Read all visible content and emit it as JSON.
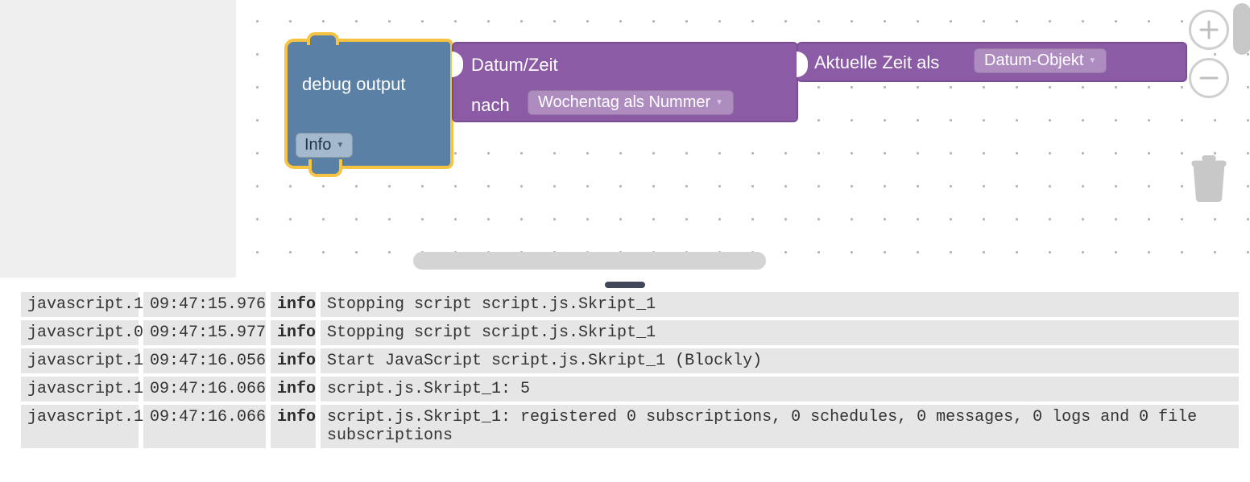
{
  "blocks": {
    "debug": {
      "label": "debug output",
      "level_field": "Info"
    },
    "datetime": {
      "header": "Datum/Zeit",
      "nach": "nach",
      "unit_field": "Wochentag als Nummer"
    },
    "now": {
      "label": "Aktuelle Zeit als",
      "format_field": "Datum-Objekt"
    }
  },
  "log": [
    {
      "source": "javascript.1",
      "time": "09:47:15.976",
      "level": "info",
      "message": "Stopping script script.js.Skript_1"
    },
    {
      "source": "javascript.0",
      "time": "09:47:15.977",
      "level": "info",
      "message": "Stopping script script.js.Skript_1"
    },
    {
      "source": "javascript.1",
      "time": "09:47:16.056",
      "level": "info",
      "message": "Start JavaScript script.js.Skript_1 (Blockly)"
    },
    {
      "source": "javascript.1",
      "time": "09:47:16.066",
      "level": "info",
      "message": "script.js.Skript_1: 5"
    },
    {
      "source": "javascript.1",
      "time": "09:47:16.066",
      "level": "info",
      "message": "script.js.Skript_1: registered 0 subscriptions, 0 schedules, 0 messages, 0 logs and 0 file subscriptions"
    }
  ]
}
